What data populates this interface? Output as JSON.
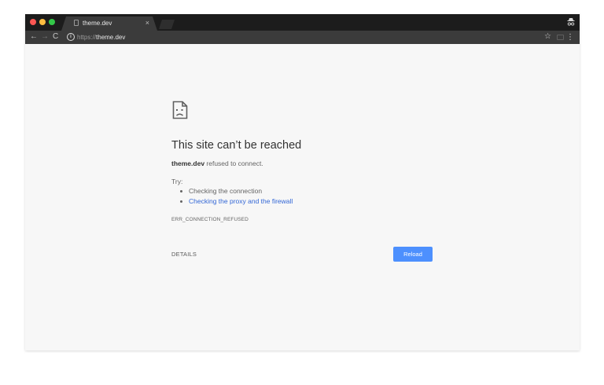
{
  "tab": {
    "title": "theme.dev",
    "close": "×"
  },
  "toolbar": {
    "back": "←",
    "forward": "→",
    "reload": "C",
    "url_scheme": "https://",
    "url_host": "theme.dev",
    "star": "☆",
    "menu": "⋮"
  },
  "icons": {
    "tab_page": "page-icon",
    "incognito": "incognito-icon",
    "info": "info-icon",
    "cast": "cast-icon",
    "error": "sad-page-icon"
  },
  "error_page": {
    "heading": "This site can’t be reached",
    "host": "theme.dev",
    "summary_rest": " refused to connect.",
    "try_label": "Try:",
    "suggestions": [
      "Checking the connection",
      "Checking the proxy and the firewall"
    ],
    "error_code": "ERR_CONNECTION_REFUSED",
    "details_label": "DETAILS",
    "reload_label": "Reload"
  },
  "colors": {
    "tabstrip": "#1c1c1c",
    "toolbar": "#3b3b3b",
    "page_background": "#f7f7f7",
    "link": "#3367d6",
    "button": "#4d90fe"
  }
}
